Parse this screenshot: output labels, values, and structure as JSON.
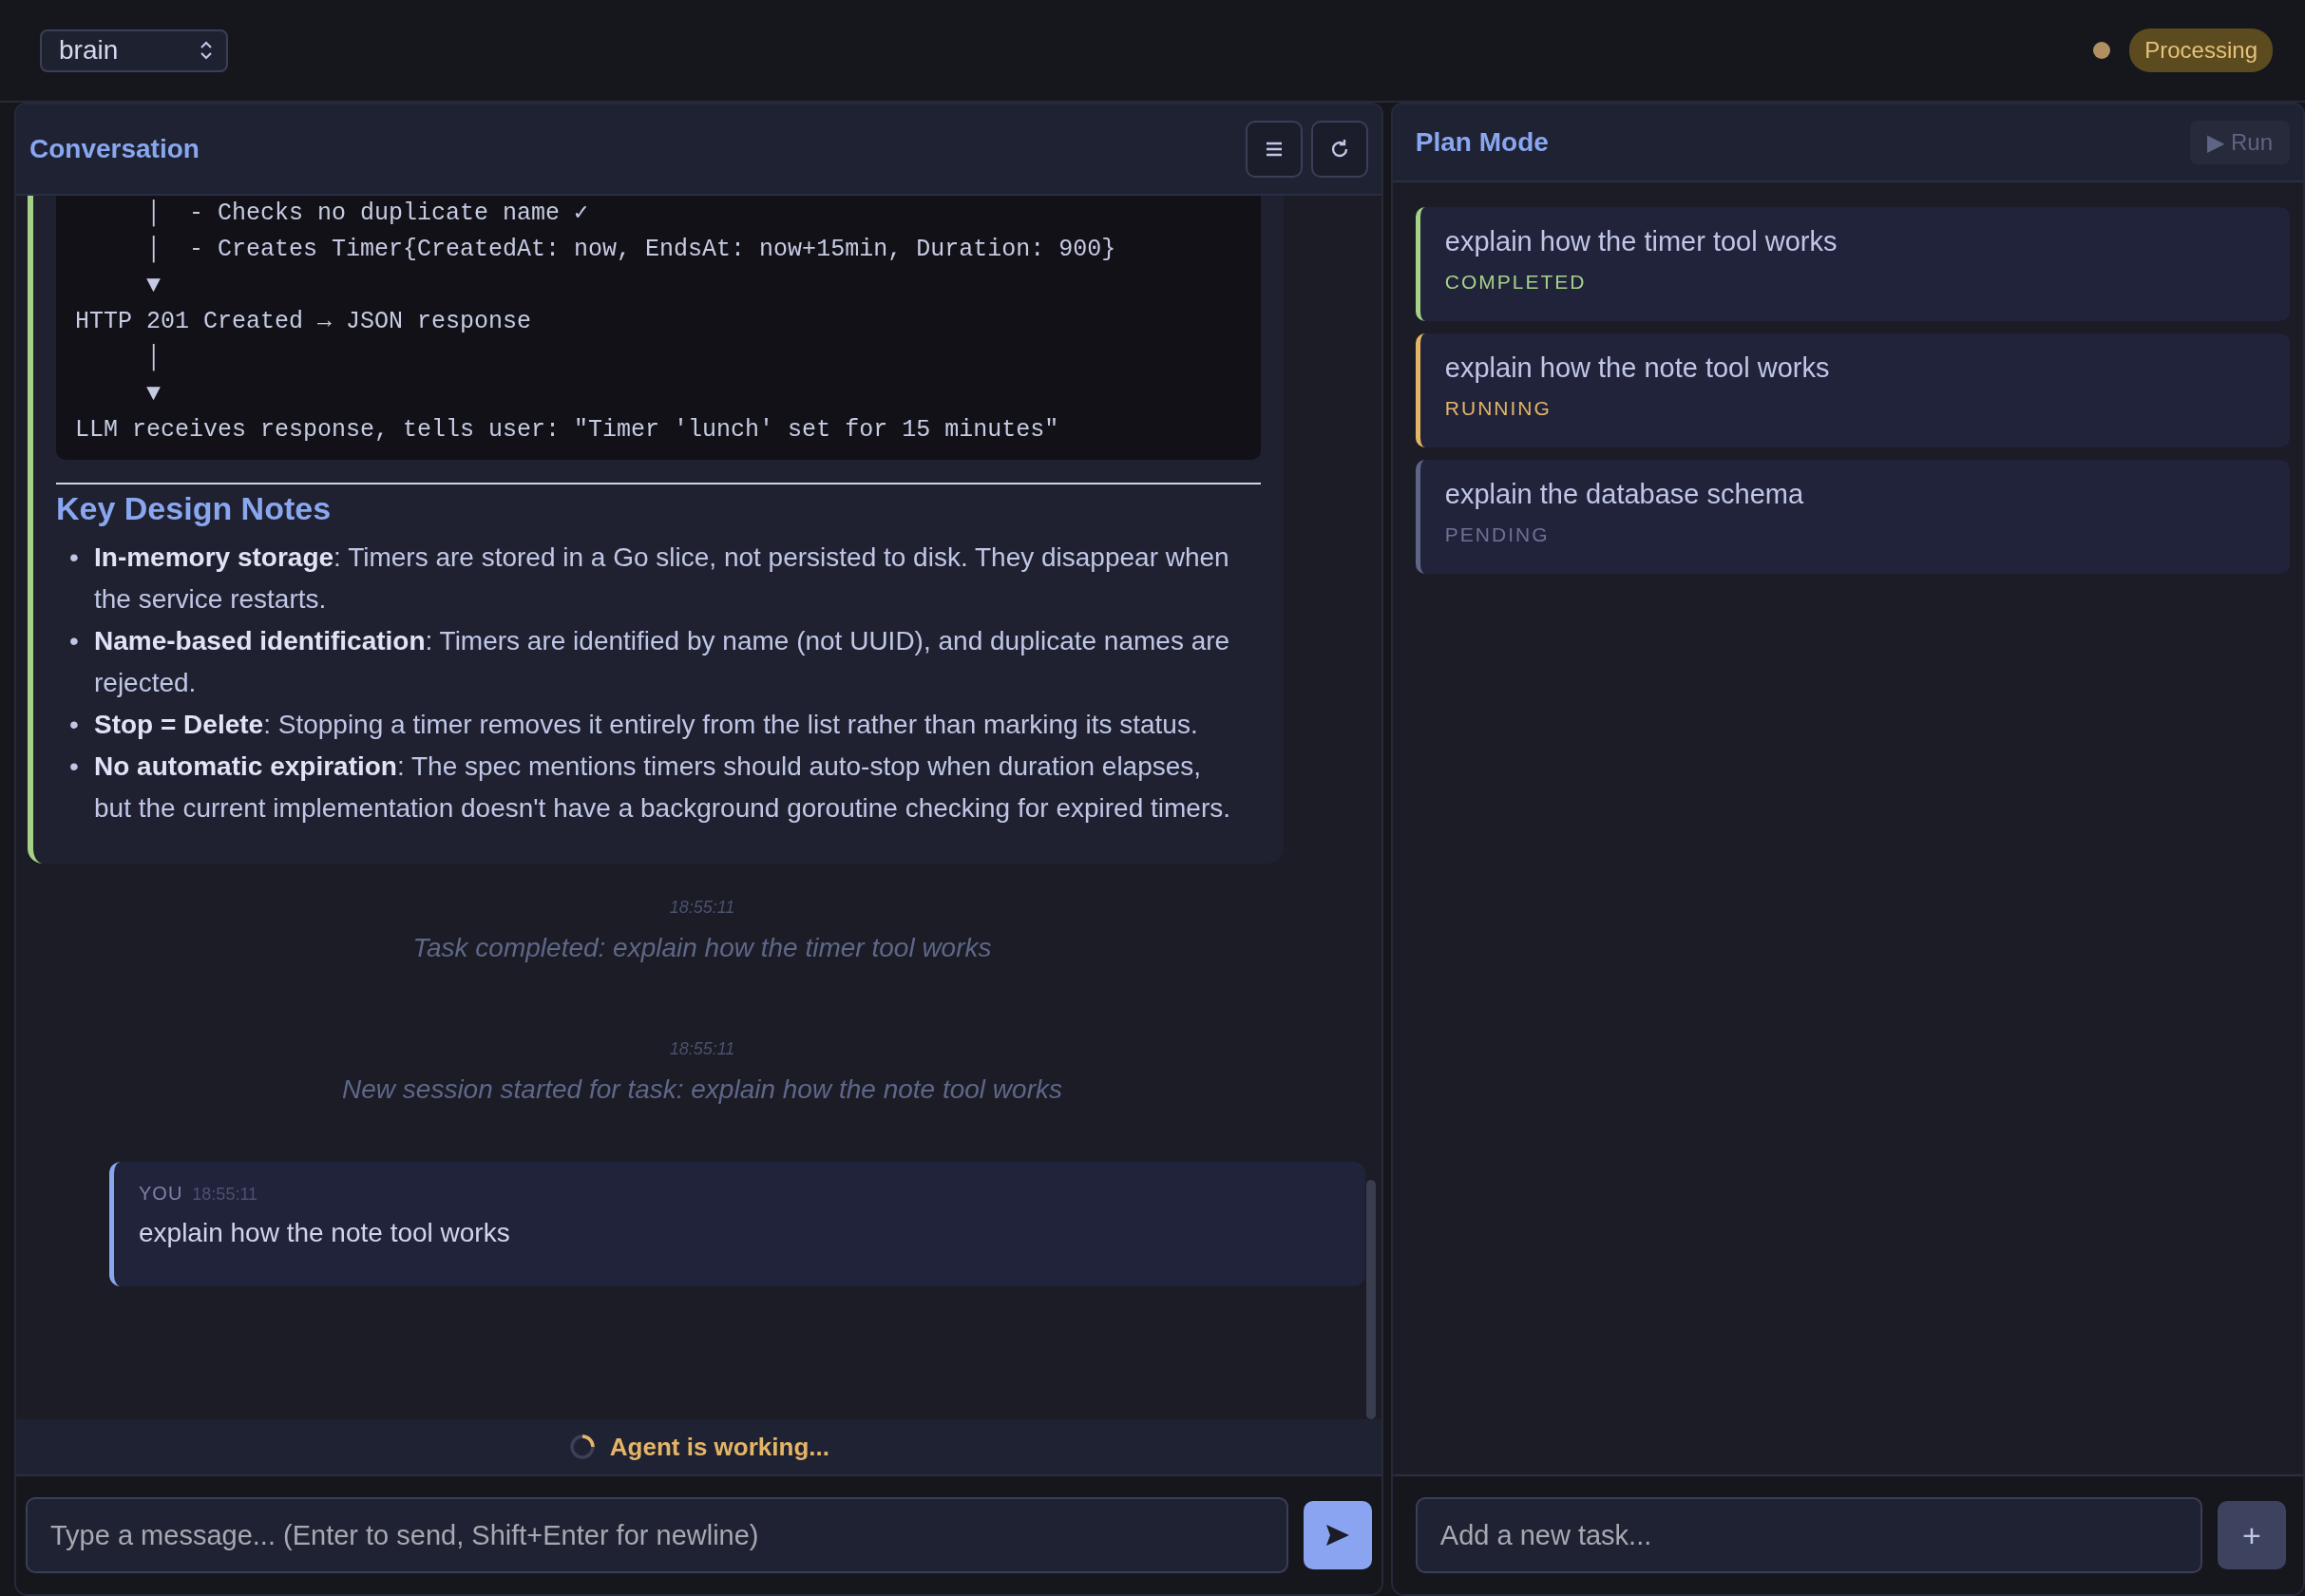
{
  "topbar": {
    "project_select": {
      "value": "brain"
    },
    "status": {
      "color": "#b09060",
      "label": "Processing"
    }
  },
  "conversation": {
    "title": "Conversation",
    "assistant_message": {
      "code_lines": [
        "     │  - Checks no duplicate name ✓",
        "     │  - Creates Timer{CreatedAt: now, EndsAt: now+15min, Duration: 900}",
        "     ▼",
        "HTTP 201 Created → JSON response",
        "     │",
        "     ▼",
        "LLM receives response, tells user: \"Timer 'lunch' set for 15 minutes\""
      ],
      "heading": "Key Design Notes",
      "bullets": [
        {
          "marker": "•",
          "text": "**In-memory storage**: Timers are stored in a Go slice, not persisted to disk. They disappear when the service restarts."
        },
        {
          "marker": "•",
          "text": "**Name-based identification**: Timers are identified by name (not UUID), and duplicate names are rejected."
        },
        {
          "marker": "•",
          "text": "**Stop = Delete**: Stopping a timer removes it entirely from the list rather than marking its status."
        },
        {
          "marker": "•",
          "text": "**No automatic expiration**: The spec mentions timers should auto-stop when duration elapses, but the current implementation doesn't have a background goroutine checking for expired timers."
        }
      ]
    },
    "events": [
      {
        "kind": "system",
        "time": "18:55:11",
        "text": "Task completed: explain how the timer tool works"
      },
      {
        "kind": "system",
        "time": "18:55:11",
        "text": "New session started for task: explain how the note tool works"
      },
      {
        "kind": "user",
        "author": "YOU",
        "time": "18:55:11",
        "text": "explain how the note tool works"
      }
    ],
    "working": {
      "text": "Agent is working..."
    },
    "input": {
      "placeholder": "Type a message... (Enter to send, Shift+Enter for newline)"
    }
  },
  "plan": {
    "title": "Plan Mode",
    "run_button": {
      "label": "▶ Run",
      "disabled": true
    },
    "tasks": [
      {
        "title": "explain how the timer tool works",
        "status": "COMPLETED",
        "kind": "completed"
      },
      {
        "title": "explain how the note tool works",
        "status": "RUNNING",
        "kind": "running"
      },
      {
        "title": "explain the database schema",
        "status": "PENDING",
        "kind": "pending"
      }
    ],
    "input": {
      "placeholder": "Add a new task..."
    },
    "add_button": {
      "label": "+"
    }
  }
}
